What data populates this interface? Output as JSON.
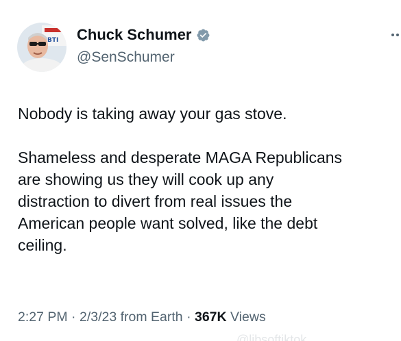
{
  "author": {
    "display_name": "Chuck Schumer",
    "handle": "@SenSchumer",
    "avatar_sign_text": "BTI"
  },
  "tweet": {
    "lines_para1": [
      "Nobody is taking away your gas stove."
    ],
    "lines_para2": [
      "Shameless and desperate MAGA Republicans",
      "are showing us they will cook up any",
      "distraction to divert from real issues the",
      "American people want solved, like the debt",
      "ceiling."
    ]
  },
  "meta": {
    "time": "2:27 PM",
    "separator": "·",
    "date": "2/3/23",
    "source": "from Earth",
    "views_count": "367K",
    "views_label": "Views"
  },
  "watermark": "@libsoftiktok",
  "icons": [
    "verified-badge-icon",
    "more-options-icon"
  ],
  "colors": {
    "text_primary": "#0f1419",
    "text_secondary": "#536471",
    "verified_badge": "#829aab"
  }
}
